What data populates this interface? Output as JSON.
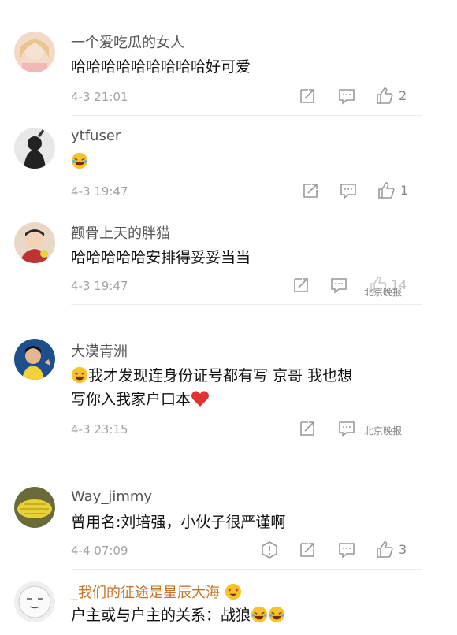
{
  "comments": [
    {
      "username": "一个爱吃瓜的女人",
      "text": "哈哈哈哈哈哈哈哈哈好可爱",
      "time": "4-3 21:01",
      "likes": "2"
    },
    {
      "username": "ytfuser",
      "text": "",
      "time": "4-3 19:47",
      "likes": "1"
    },
    {
      "username": "颧骨上天的胖猫",
      "text": "哈哈哈哈哈安排得妥妥当当",
      "time": "4-3 19:47",
      "likes": "14"
    },
    {
      "username": "大漠青洲",
      "text_line1": "我才发现连身份证号都有写 京哥 我也想",
      "text_line2": "写你入我家户口本",
      "time": "4-3 23:15"
    },
    {
      "username": "Way_jimmy",
      "text": "曾用名:刘培强，小伙子很严谨啊",
      "time": "4-4 07:09",
      "likes": "3"
    },
    {
      "username": "_我们的征途是星辰大海",
      "text": "户主或与户主的关系：战狼"
    }
  ],
  "watermark": "北京晚报",
  "icons": {
    "share": "share-icon",
    "comment": "comment-icon",
    "like": "thumbs-up-icon",
    "warning": "warning-icon",
    "laugh": "laughing-emoji-icon",
    "heart": "heart-icon"
  }
}
